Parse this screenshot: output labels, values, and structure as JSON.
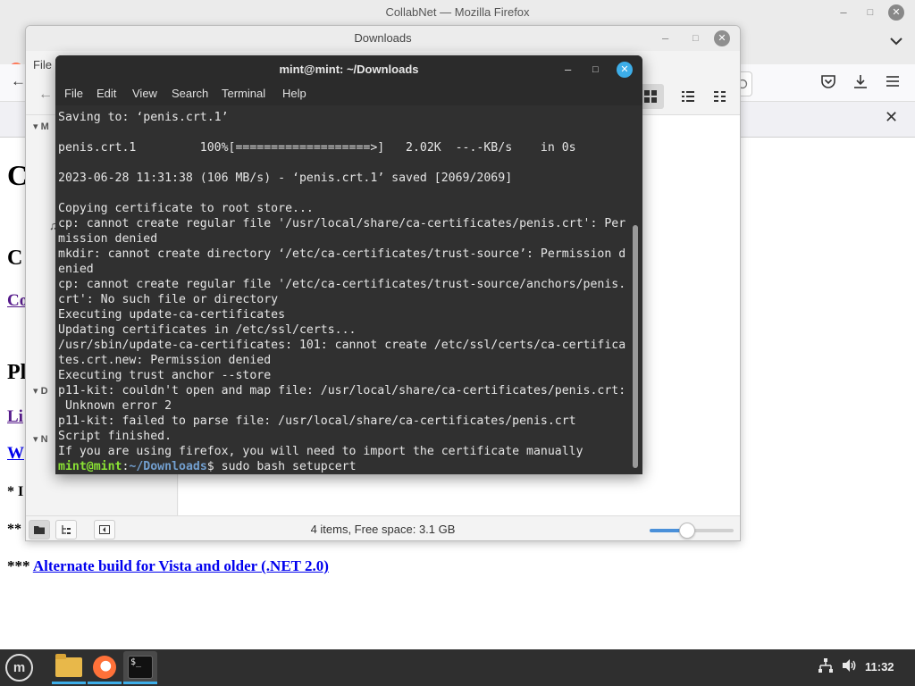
{
  "firefox": {
    "window_title": "CollabNet — Mozilla Firefox",
    "page": {
      "heading_big": "C",
      "heading_med": "C",
      "link_co": "Co",
      "heading_p": "Pl",
      "link_li": "Li",
      "link_w": "W",
      "star_line_1": "* I",
      "star_line_2": "**",
      "alt_prefix": "***",
      "alt_link": "Alternate build for Vista and older (.NET 2.0)"
    }
  },
  "nemo": {
    "window_title": "Downloads",
    "menu_file": "File",
    "sidebar": {
      "sec_m": "M",
      "sec_d": "D",
      "sec_n": "N"
    },
    "status_text": "4 items, Free space: 3.1 GB",
    "zoom_level": 0.45
  },
  "terminal": {
    "window_title": "mint@mint: ~/Downloads",
    "menu": [
      "File",
      "Edit",
      "View",
      "Search",
      "Terminal",
      "Help"
    ],
    "lines": [
      "Saving to: ‘penis.crt.1’",
      "",
      "penis.crt.1         100%[===================>]   2.02K  --.-KB/s    in 0s",
      "",
      "2023-06-28 11:31:38 (106 MB/s) - ‘penis.crt.1’ saved [2069/2069]",
      "",
      "Copying certificate to root store...",
      "cp: cannot create regular file '/usr/local/share/ca-certificates/penis.crt': Per",
      "mission denied",
      "mkdir: cannot create directory ‘/etc/ca-certificates/trust-source’: Permission d",
      "enied",
      "cp: cannot create regular file '/etc/ca-certificates/trust-source/anchors/penis.",
      "crt': No such file or directory",
      "Executing update-ca-certificates",
      "Updating certificates in /etc/ssl/certs...",
      "/usr/sbin/update-ca-certificates: 101: cannot create /etc/ssl/certs/ca-certifica",
      "tes.crt.new: Permission denied",
      "Executing trust anchor --store",
      "p11-kit: couldn't open and map file: /usr/local/share/ca-certificates/penis.crt:",
      " Unknown error 2",
      "p11-kit: failed to parse file: /usr/local/share/ca-certificates/penis.crt",
      "Script finished.",
      "If you are using firefox, you will need to import the certificate manually"
    ],
    "prompt_user": "mint@mint",
    "prompt_sep": ":",
    "prompt_path": "~/Downloads",
    "prompt_dollar": "$ ",
    "prompt_command": "sudo bash setupcert"
  },
  "taskbar": {
    "clock": "11:32",
    "terminal_icon_text": "$_"
  },
  "icons": {
    "minimize": "–",
    "maximize": "□",
    "close": "✕",
    "back": "←",
    "chevron_down": "⌄"
  },
  "colors": {
    "terminal_bg": "#303030",
    "prompt_user": "#8ae234",
    "prompt_path": "#729fcf",
    "accent": "#3daee9",
    "link": "#551a8b"
  }
}
